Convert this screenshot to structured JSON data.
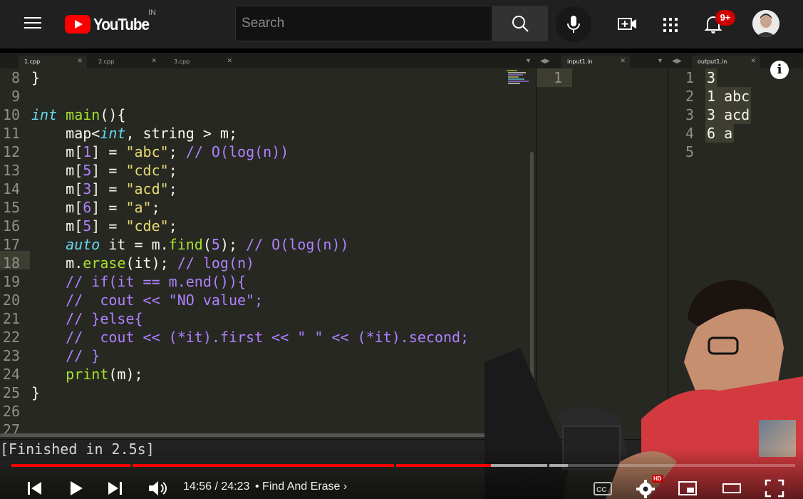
{
  "header": {
    "logo_text": "YouTube",
    "region": "IN",
    "search_placeholder": "Search",
    "notification_count": "9+"
  },
  "editor": {
    "tabs": [
      "1.cpp",
      "2.cpp",
      "3.cpp"
    ],
    "input_tab": "input1.in",
    "output_tab": "output1.in",
    "lines": [
      {
        "num": "8",
        "code": [
          {
            "t": "}",
            "c": "w"
          }
        ]
      },
      {
        "num": "9",
        "code": []
      },
      {
        "num": "10",
        "code": [
          {
            "t": "int",
            "c": "k"
          },
          {
            "t": " ",
            "c": "w"
          },
          {
            "t": "main",
            "c": "f"
          },
          {
            "t": "(){",
            "c": "w"
          }
        ]
      },
      {
        "num": "11",
        "code": [
          {
            "t": "    map<",
            "c": "w"
          },
          {
            "t": "int",
            "c": "k"
          },
          {
            "t": ", string > m;",
            "c": "w"
          }
        ]
      },
      {
        "num": "12",
        "code": [
          {
            "t": "    m[",
            "c": "w"
          },
          {
            "t": "1",
            "c": "n"
          },
          {
            "t": "] = ",
            "c": "w"
          },
          {
            "t": "\"abc\"",
            "c": "s"
          },
          {
            "t": "; ",
            "c": "w"
          },
          {
            "t": "// O(log(n))",
            "c": "c"
          }
        ]
      },
      {
        "num": "13",
        "code": [
          {
            "t": "    m[",
            "c": "w"
          },
          {
            "t": "5",
            "c": "n"
          },
          {
            "t": "] = ",
            "c": "w"
          },
          {
            "t": "\"cdc\"",
            "c": "s"
          },
          {
            "t": ";",
            "c": "w"
          }
        ]
      },
      {
        "num": "14",
        "code": [
          {
            "t": "    m[",
            "c": "w"
          },
          {
            "t": "3",
            "c": "n"
          },
          {
            "t": "] = ",
            "c": "w"
          },
          {
            "t": "\"acd\"",
            "c": "s"
          },
          {
            "t": ";",
            "c": "w"
          }
        ]
      },
      {
        "num": "15",
        "code": [
          {
            "t": "    m[",
            "c": "w"
          },
          {
            "t": "6",
            "c": "n"
          },
          {
            "t": "] = ",
            "c": "w"
          },
          {
            "t": "\"a\"",
            "c": "s"
          },
          {
            "t": ";",
            "c": "w"
          }
        ]
      },
      {
        "num": "16",
        "code": [
          {
            "t": "    m[",
            "c": "w"
          },
          {
            "t": "5",
            "c": "n"
          },
          {
            "t": "] = ",
            "c": "w"
          },
          {
            "t": "\"cde\"",
            "c": "s"
          },
          {
            "t": ";",
            "c": "w"
          }
        ]
      },
      {
        "num": "17",
        "code": [
          {
            "t": "    ",
            "c": "w"
          },
          {
            "t": "auto",
            "c": "k"
          },
          {
            "t": " it = m.",
            "c": "w"
          },
          {
            "t": "find",
            "c": "f"
          },
          {
            "t": "(",
            "c": "w"
          },
          {
            "t": "5",
            "c": "n"
          },
          {
            "t": "); ",
            "c": "w"
          },
          {
            "t": "// O(log(n))",
            "c": "c"
          }
        ]
      },
      {
        "num": "18",
        "code": [
          {
            "t": "    m.",
            "c": "w"
          },
          {
            "t": "erase",
            "c": "f"
          },
          {
            "t": "(it); ",
            "c": "w"
          },
          {
            "t": "// log(n)",
            "c": "c"
          }
        ]
      },
      {
        "num": "19",
        "code": [
          {
            "t": "    // if(it == m.end()){",
            "c": "c"
          }
        ]
      },
      {
        "num": "20",
        "code": [
          {
            "t": "    //  cout << \"NO value\";",
            "c": "c"
          }
        ]
      },
      {
        "num": "21",
        "code": [
          {
            "t": "    // }else{",
            "c": "c"
          }
        ]
      },
      {
        "num": "22",
        "code": [
          {
            "t": "    //  cout << (*it).first << \" \" << (*it).second;",
            "c": "c"
          }
        ]
      },
      {
        "num": "23",
        "code": [
          {
            "t": "    // }",
            "c": "c"
          }
        ]
      },
      {
        "num": "24",
        "code": [
          {
            "t": "    ",
            "c": "w"
          },
          {
            "t": "print",
            "c": "f"
          },
          {
            "t": "(m);",
            "c": "w"
          }
        ]
      },
      {
        "num": "25",
        "code": [
          {
            "t": "}",
            "c": "w"
          }
        ]
      },
      {
        "num": "26",
        "code": []
      },
      {
        "num": "27",
        "code": []
      }
    ],
    "input_lines": [
      "1"
    ],
    "output_lines": [
      {
        "num": "1",
        "text": "3"
      },
      {
        "num": "2",
        "text": "1 abc"
      },
      {
        "num": "3",
        "text": "3 acd"
      },
      {
        "num": "4",
        "text": "6 a"
      },
      {
        "num": "5",
        "text": ""
      }
    ],
    "build_output": "[Finished in 2.5s]"
  },
  "player": {
    "current_time": "14:56",
    "duration": "24:23",
    "time_display": "14:56 / 24:23",
    "chapter_title": "Find And Erase",
    "played_fraction": 0.612,
    "buffered_fraction": 0.71,
    "quality_badge": "HD",
    "accent": "#ff0000"
  },
  "colors": {
    "editor_bg": "#272822",
    "keyword": "#66d9ef",
    "function": "#a6e22e",
    "number": "#ae81ff",
    "string": "#e6db74",
    "comment": "#ae81ff"
  }
}
